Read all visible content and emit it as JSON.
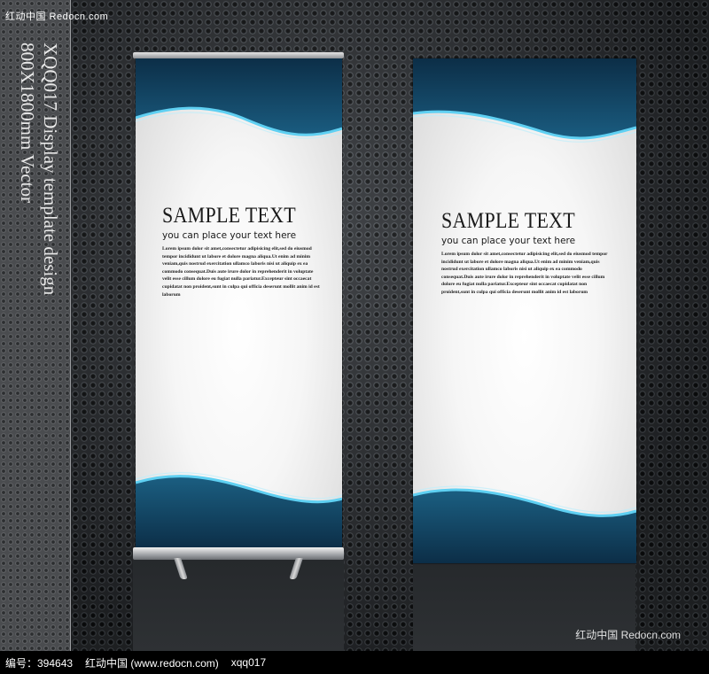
{
  "watermark": {
    "top_left": "红动中国 Redocn.com",
    "bottom_right": "红动中国 Redocn.com"
  },
  "vertical_title": {
    "line1": "XQQ017 Display template design",
    "line2": "800X1800mm Vector"
  },
  "banners": [
    {
      "title": "SAMPLE TEXT",
      "subtitle": "you can place your text here",
      "body": "Lorem ipsum dolor sit amet,consectetur adipisicing elit,sed do eiusmod tempor incididunt ut labore et dolore magna aliqua.Ut enim ad minim veniam,quis nostrud exercitation ullamco laboris nisi ut aliquip ex ea commodo consequat.Duis aute irure dolor in reprehenderit in voluptate velit esse cillum dolore eu fugiat nulla pariatur.Excepteur sint occaecat cupidatat non proident,sunt in culpa qui officia deserunt mollit anim id est laborum"
    },
    {
      "title": "SAMPLE TEXT",
      "subtitle": "you can place your text here",
      "body": "Lorem ipsum dolor sit amet,consectetur adipisicing elit,sed do eiusmod tempor incididunt ut labore et dolore magna aliqua.Ut enim ad minim veniam,quis nostrud exercitation ullamco laboris nisi ut aliquip ex ea commodo consequat.Duis aute irure dolor in reprehenderit in voluptate velit esse cillum dolore eu fugiat nulla pariatur.Excepteur sint occaecat cupidatat non proident,sunt in culpa qui officia deserunt mollit anim id est laborum"
    }
  ],
  "footer": {
    "id_label": "编号：394643",
    "site": "红动中国 (www.redocn.com)",
    "code": "xqq017"
  },
  "colors": {
    "wave_dark": "#0e3550",
    "wave_mid": "#1b5f82",
    "wave_accent": "#5fd0f2"
  }
}
